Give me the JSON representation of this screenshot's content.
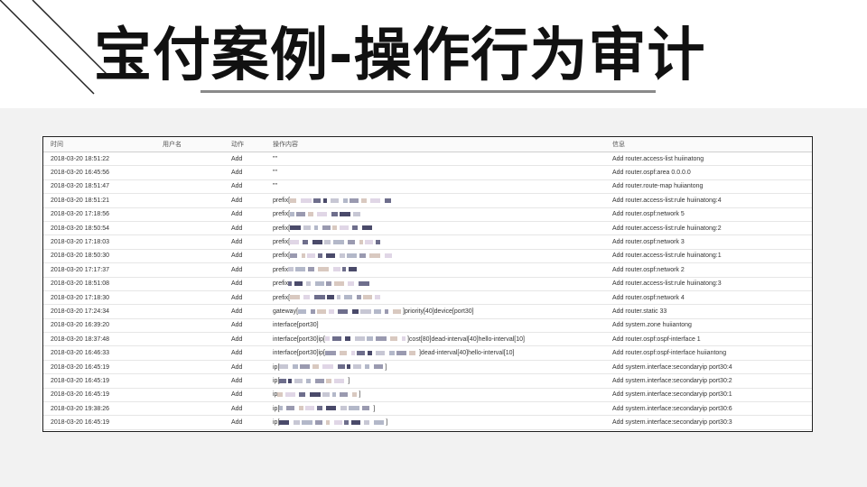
{
  "slide": {
    "title": "宝付案例-操作行为审计"
  },
  "table": {
    "headers": {
      "time": "时间",
      "user": "用户名",
      "action": "动作",
      "content": "操作内容",
      "info": "信息"
    },
    "rows": [
      {
        "time": "2018-03-20 18:51:22",
        "action": "Add",
        "content": "\"\"",
        "info": "Add router.access-list huiinatong"
      },
      {
        "time": "2018-03-20 16:45:56",
        "action": "Add",
        "content": "\"\"",
        "info": "Add router.ospf:area 0.0.0.0"
      },
      {
        "time": "2018-03-20 18:51:47",
        "action": "Add",
        "content": "\"\"",
        "info": "Add router.route-map huiiantong"
      },
      {
        "time": "2018-03-20 18:51:21",
        "action": "Add",
        "content": "prefix[",
        "info": "Add router.access-list:rule huiinatong:4"
      },
      {
        "time": "2018-03-20 17:18:56",
        "action": "Add",
        "content": "prefix[",
        "info": "Add router.ospf:network 5"
      },
      {
        "time": "2018-03-20 18:50:54",
        "action": "Add",
        "content": "prefix[",
        "info": "Add router.access-list:rule huiinatong:2"
      },
      {
        "time": "2018-03-20 17:18:03",
        "action": "Add",
        "content": "prefix[",
        "info": "Add router.ospf:network 3"
      },
      {
        "time": "2018-03-20 18:50:30",
        "action": "Add",
        "content": "prefix[",
        "info": "Add router.access-list:rule huiinatong:1"
      },
      {
        "time": "2018-03-20 17:17:37",
        "action": "Add",
        "content": "prefix",
        "info": "Add router.ospf:network 2"
      },
      {
        "time": "2018-03-20 18:51:08",
        "action": "Add",
        "content": "prefix",
        "info": "Add router.access-list:rule huiinatong:3"
      },
      {
        "time": "2018-03-20 17:18:30",
        "action": "Add",
        "content": "prefix[",
        "info": "Add router.ospf:network 4"
      },
      {
        "time": "2018-03-20 17:24:34",
        "action": "Add",
        "content": "gateway[",
        "content_tail": "]priority[40]device[port30]",
        "info": "Add router.static 33"
      },
      {
        "time": "2018-03-20 16:39:20",
        "action": "Add",
        "content": "interface[port30]",
        "info": "Add system.zone huiiantong"
      },
      {
        "time": "2018-03-20 18:37:48",
        "action": "Add",
        "content": "interface[port30]ip[",
        "content_tail": "]cost[80]dead-interval[40]hello-interval[10]",
        "info": "Add router.ospf:ospf-interface 1"
      },
      {
        "time": "2018-03-20 16:46:33",
        "action": "Add",
        "content": "interface[port30]ip[",
        "content_tail": "]dead-interval[40]hello-interval[10]",
        "info": "Add router.ospf:ospf-interface huiiantong"
      },
      {
        "time": "2018-03-20 16:45:19",
        "action": "Add",
        "content": "ip[",
        "content_tail": "]",
        "info": "Add system.interface:secondaryip port30:4"
      },
      {
        "time": "2018-03-20 16:45:19",
        "action": "Add",
        "content": "ip[",
        "content_tail": "]",
        "info": "Add system.interface:secondaryip port30:2"
      },
      {
        "time": "2018-03-20 16:45:19",
        "action": "Add",
        "content": "ip",
        "content_tail": "]",
        "info": "Add system.interface:secondaryip port30:1"
      },
      {
        "time": "2018-03-20 19:38:26",
        "action": "Add",
        "content": "ip[",
        "content_tail": "]",
        "info": "Add system.interface:secondaryip port30:6"
      },
      {
        "time": "2018-03-20 16:45:19",
        "action": "Add",
        "content": "ip[",
        "content_tail": "]",
        "info": "Add system.interface:secondaryip port30:3"
      }
    ]
  }
}
